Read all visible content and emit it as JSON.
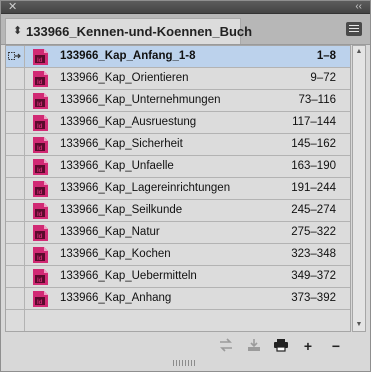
{
  "window": {
    "close_glyph": "✕",
    "collapse_glyph": "‹‹"
  },
  "tab": {
    "arrow_icon": "chevron-updown-icon",
    "title": "133966_Kennen-und-Koennen_Buch"
  },
  "documents": [
    {
      "name": "133966_Kap_Anfang_1-8",
      "pages": "1–8",
      "selected": true,
      "status": "sync-source"
    },
    {
      "name": "133966_Kap_Orientieren",
      "pages": "9–72"
    },
    {
      "name": "133966_Kap_Unternehmungen",
      "pages": "73–116"
    },
    {
      "name": "133966_Kap_Ausruestung",
      "pages": "117–144"
    },
    {
      "name": "133966_Kap_Sicherheit",
      "pages": "145–162"
    },
    {
      "name": "133966_Kap_Unfaelle",
      "pages": "163–190"
    },
    {
      "name": "133966_Kap_Lagereinrichtungen",
      "pages": "191–244"
    },
    {
      "name": "133966_Kap_Seilkunde",
      "pages": "245–274"
    },
    {
      "name": "133966_Kap_Natur",
      "pages": "275–322"
    },
    {
      "name": "133966_Kap_Kochen",
      "pages": "323–348"
    },
    {
      "name": "133966_Kap_Uebermitteln",
      "pages": "349–372"
    },
    {
      "name": "133966_Kap_Anhang",
      "pages": "373–392"
    }
  ],
  "toolbar": {
    "sync_icon": "synchronize-icon",
    "save_icon": "save-book-icon",
    "print_icon": "print-icon",
    "add_label": "+",
    "remove_label": "−"
  },
  "colors": {
    "selection": "#bcd2ec",
    "indesign_icon": "#d12a74"
  }
}
